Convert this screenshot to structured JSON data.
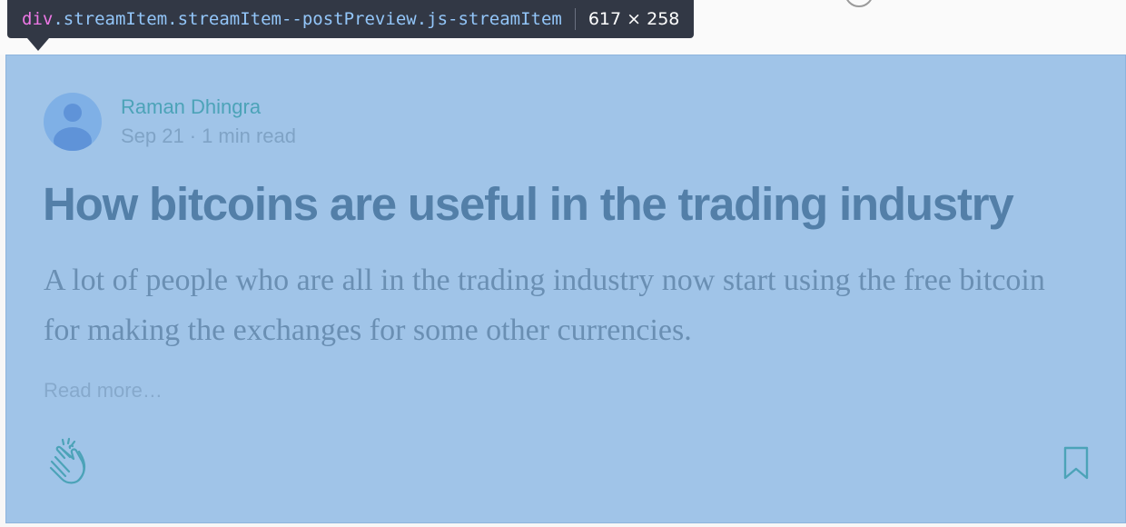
{
  "inspector": {
    "tag": "div",
    "classes": ".streamItem.streamItem--postPreview.js-streamItem",
    "dimensions": "617 × 258"
  },
  "post": {
    "author": "Raman Dhingra",
    "date": "Sep 21",
    "separator": "·",
    "read_time": "1 min read",
    "title": "How bitcoins are useful in the trading industry",
    "excerpt": "A lot of people who are all in the trading industry now start using the free bitcoin for making the exchanges for some other currencies.",
    "read_more": "Read more…"
  },
  "icons": {
    "avatar": "user-avatar-icon",
    "clap": "clap-icon",
    "bookmark": "bookmark-icon"
  },
  "colors": {
    "highlight": "#a0c4e8",
    "title": "#537fa8",
    "author": "#4ca3b8",
    "tooltip_bg": "#323845"
  }
}
